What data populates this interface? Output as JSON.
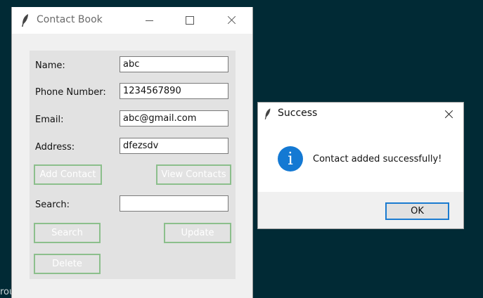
{
  "main_window": {
    "title": "Contact Book",
    "form": {
      "name_label": "Name:",
      "name_value": "abc",
      "phone_label": "Phone Number:",
      "phone_value": "1234567890",
      "email_label": "Email:",
      "email_value": "abc@gmail.com",
      "address_label": "Address:",
      "address_value": "dfezsdv",
      "search_label": "Search:",
      "search_value": ""
    },
    "buttons": {
      "add_contact": "Add Contact",
      "view_contacts": "View Contacts",
      "search": "Search",
      "update": "Update",
      "delete": "Delete"
    }
  },
  "dialog": {
    "title": "Success",
    "message": "Contact added successfully!",
    "ok_label": "OK",
    "icon": "info-icon"
  },
  "background_text": "rou",
  "colors": {
    "desktop": "#012a35",
    "button_border": "#8cbf8c",
    "info_blue": "#1479d3",
    "ok_border": "#1a7bd0"
  }
}
